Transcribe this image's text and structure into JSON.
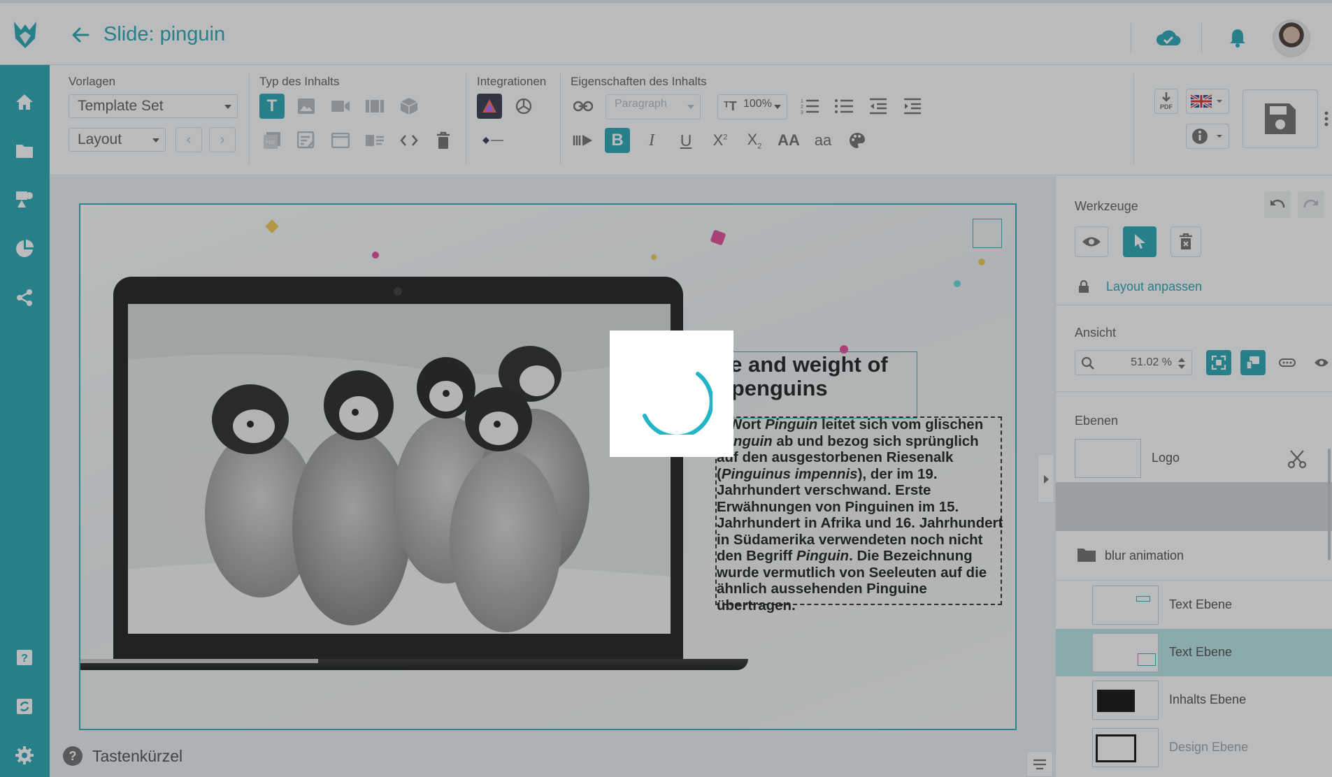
{
  "header": {
    "title": "Slide: pinguin"
  },
  "toolbar": {
    "vorlagen_label": "Vorlagen",
    "template_set": "Template Set",
    "layout": "Layout",
    "typ_label": "Typ des Inhalts",
    "integrationen_label": "Integrationen",
    "eigenschaften_label": "Eigenschaften des Inhalts",
    "paragraph": "Paragraph",
    "font_size": "100%",
    "pdf_label": "PDF",
    "superscript": "2",
    "subscript": "2"
  },
  "slide": {
    "title_line1": "ize and weight of",
    "title_line2": "e penguins",
    "body_parts": {
      "p1": "s Wort ",
      "i1": "Pinguin",
      "p2": " leitet sich vom glischen ",
      "i2": "penguin",
      "p3": " ab und bezog sich sprünglich auf den ausgestorbenen Riesenalk (",
      "i3": "Pinguinus impennis",
      "p4": "), der im 19. Jahrhundert verschwand. Erste Erwähnungen von Pinguinen im 15. Jahrhundert in Afrika und 16. Jahrhundert in Südamerika verwendeten noch nicht den Begriff ",
      "i4": "Pinguin",
      "p5": ". Die Bezeichnung wurde vermutlich von Seeleuten auf die ähnlich aussehenden Pinguine übertragen."
    }
  },
  "footer": {
    "shortcuts": "Tastenkürzel"
  },
  "right_panel": {
    "werkzeuge": "Werkzeuge",
    "layout_anpassen": "Layout anpassen",
    "ansicht": "Ansicht",
    "zoom": "51.02 %",
    "ebenen": "Ebenen",
    "layers": [
      {
        "name": "Logo"
      },
      {
        "name": "blur animation"
      },
      {
        "name": "Text Ebene"
      },
      {
        "name": "Text Ebene"
      },
      {
        "name": "Inhalts Ebene"
      },
      {
        "name": "Design Ebene"
      }
    ]
  },
  "colors": {
    "accent": "#1aa2b0",
    "selected_row": "#b8e5ea"
  }
}
